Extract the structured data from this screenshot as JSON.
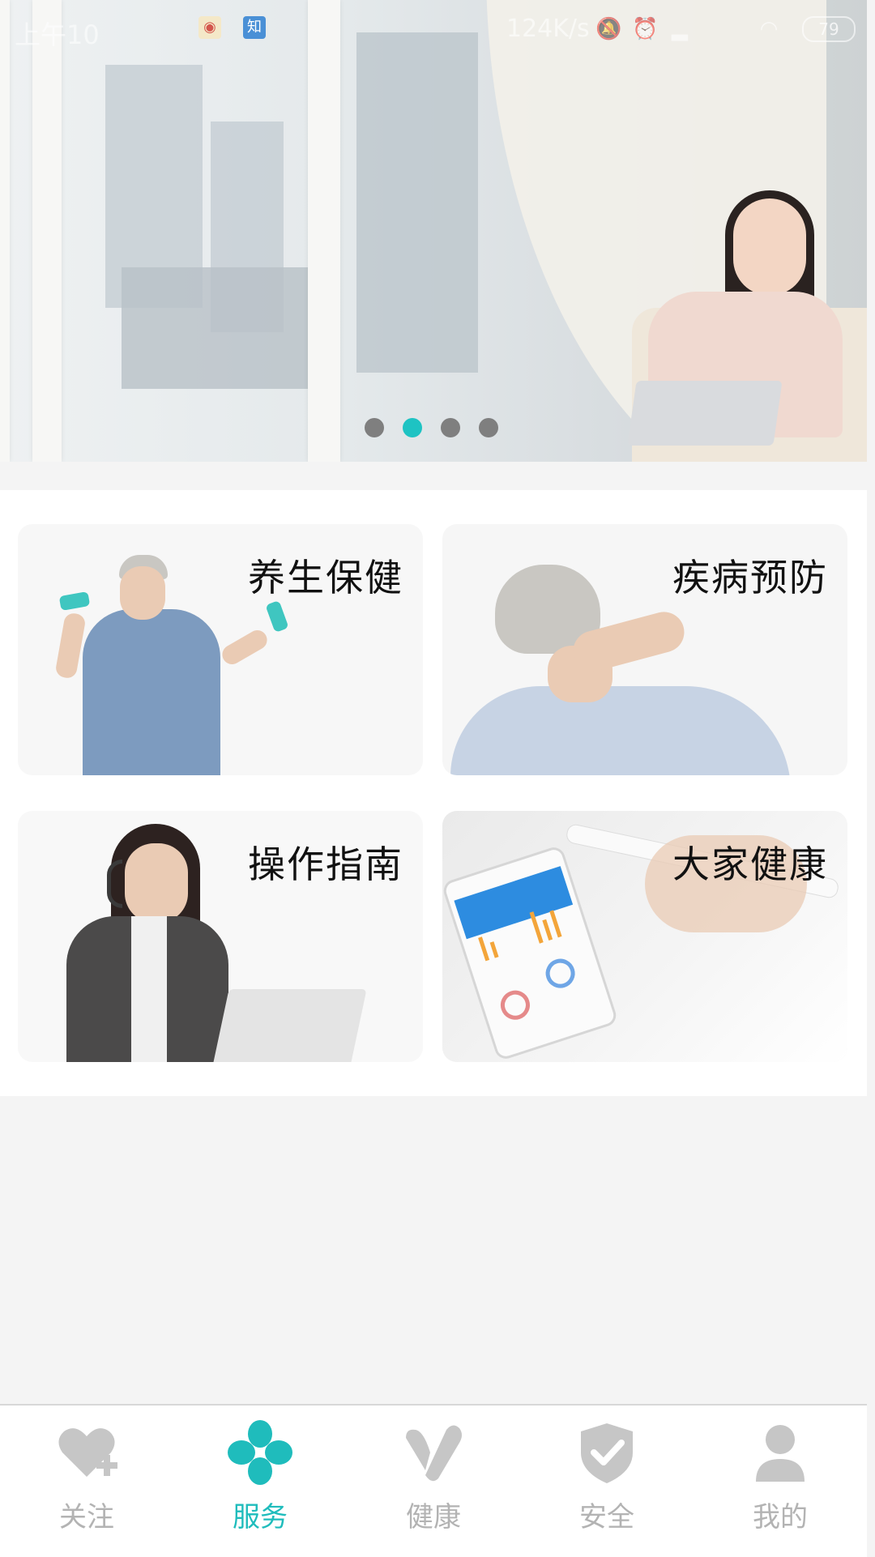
{
  "status_bar": {
    "time": "上午10",
    "app_icon_1": "weibo-icon",
    "app_icon_2": "知",
    "speed": "124K/s",
    "battery": "79"
  },
  "banner": {
    "pages": 4,
    "active_page": 2
  },
  "tiles": [
    {
      "label": "养生保健"
    },
    {
      "label": "疾病预防"
    },
    {
      "label": "操作指南"
    },
    {
      "label": "大家健康"
    }
  ],
  "nav": {
    "items": [
      {
        "label": "关注",
        "icon": "heart-plus-icon"
      },
      {
        "label": "服务",
        "icon": "clover-icon"
      },
      {
        "label": "健康",
        "icon": "check-icon"
      },
      {
        "label": "安全",
        "icon": "shield-check-icon"
      },
      {
        "label": "我的",
        "icon": "user-icon"
      }
    ],
    "active_index": 1
  },
  "colors": {
    "accent": "#1fbcbc",
    "inactive": "#b3b3b3"
  }
}
